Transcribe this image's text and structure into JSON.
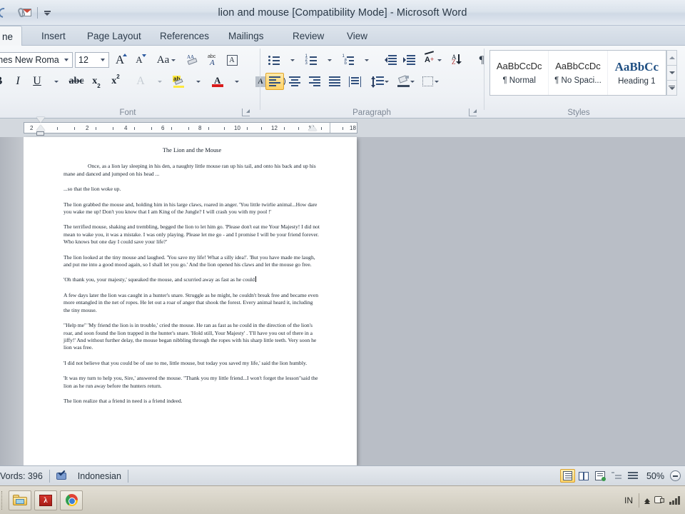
{
  "window": {
    "title": "lion and mouse [Compatibility Mode]  -  Microsoft Word",
    "qat": {
      "undo_icon": "undo-arrow-icon",
      "email_icon": "email-attachment-icon",
      "customize_icon": "customize-quick-access-toolbar-icon"
    }
  },
  "tabs": [
    {
      "label": "ne",
      "name": "tab-home",
      "active": true
    },
    {
      "label": "Insert",
      "name": "tab-insert",
      "active": false
    },
    {
      "label": "Page Layout",
      "name": "tab-page-layout",
      "active": false
    },
    {
      "label": "References",
      "name": "tab-references",
      "active": false
    },
    {
      "label": "Mailings",
      "name": "tab-mailings",
      "active": false
    },
    {
      "label": "Review",
      "name": "tab-review",
      "active": false
    },
    {
      "label": "View",
      "name": "tab-view",
      "active": false
    }
  ],
  "ribbon": {
    "font_group": {
      "label": "Font",
      "font_name": "imes New Roma",
      "font_size": "12",
      "grow_font": "A",
      "shrink_font": "A",
      "change_case": "Aa",
      "clear_formatting": "clear-formatting-icon",
      "phonetic_guide": "abc",
      "character_border": "A",
      "bold": "B",
      "italic": "I",
      "underline": "U",
      "strikethrough": "abc",
      "subscript": "x",
      "superscript": "x",
      "text_effects": "A",
      "highlight": "ab",
      "font_color": "A",
      "shading_char": "A",
      "enclose_char": "enclose-characters-icon"
    },
    "paragraph_group": {
      "label": "Paragraph",
      "bullets": "bullet-list-icon",
      "numbering": "numbered-list-icon",
      "multilevel": "multilevel-list-icon",
      "decrease_indent": "decrease-indent-icon",
      "increase_indent": "increase-indent-icon",
      "sort": "sort-icon",
      "show_marks": "¶",
      "align_left": "align-left-icon",
      "align_center": "align-center-icon",
      "align_right": "align-right-icon",
      "justify": "justify-icon",
      "distributed": "distributed-icon",
      "line_spacing": "line-spacing-icon",
      "shading": "shading-icon",
      "borders": "borders-icon",
      "active_alignment": "align-left"
    },
    "styles_group": {
      "label": "Styles",
      "items": [
        {
          "preview": "AaBbCcDc",
          "name": "¶ Normal"
        },
        {
          "preview": "AaBbCcDc",
          "name": "¶ No Spaci..."
        },
        {
          "preview": "AaBbCс",
          "name": "Heading 1"
        }
      ],
      "scroll_up": "scroll-up-icon",
      "scroll_down": "scroll-down-icon",
      "more_styles": "more-styles-icon"
    }
  },
  "ruler": {
    "marks": [
      "2",
      "2",
      "4",
      "6",
      "8",
      "10",
      "12",
      "14",
      "18"
    ],
    "first_line_indent": "first-line-indent-marker",
    "hanging_indent": "hanging-indent-marker",
    "left_indent": "left-indent-marker",
    "right_indent": "right-indent-marker"
  },
  "document": {
    "title": "The Lion and the Mouse",
    "paragraphs": [
      "Once, as a lion lay sleeping in his den, a naughty little mouse ran up his tail, and onto his back and up his mane and danced and jumped on his head ...",
      "...so that the lion woke up.",
      "The lion grabbed the mouse and, holding him in his large claws, roared in anger. 'You little twirlie animal...How dare you wake me up! Don't you know that I am King of the Jungle? I will crash you with my pool !'",
      "The terrified mouse, shaking and trembling, begged the lion to let him go. 'Please don't eat me Your Majesty! I did not mean to wake you, it was a mistake. I was only playing. Please let me go - and I promise I will be your friend forever. Who knows but one day I could save your life?'",
      "The lion looked at the tiny mouse and laughed. 'You save my life! What a silly idea!'. 'But you have made me laugh, and put me into a good mood again, so I shall let you go.' And the lion opened his claws and let the mouse go free.",
      "'Oh thank you, your majesty,' squeaked the mouse, and scurried away as fast as he could",
      "A few days later the lion was caught in a hunter's snare. Struggle as he might, he couldn't break free and became even more entangled in the net of ropes. He let out a roar of anger that shook the forest. Every animal heard it, including the tiny mouse.",
      "\"Help me\" 'My friend the lion is in trouble,' cried the mouse. He ran as fast as he could in the direction of the lion's roar, and soon found the lion trapped in the hunter's snare. 'Hold still, Your Majesty' . 'I'll have you out of there in a jiffy!' And without further delay, the mouse began nibbling through the ropes with his sharp little teeth. Very soon he lion was free.",
      "'I did not believe that you could be of use to me, little mouse, but today you saved my life,' said the lion humbly.",
      "'It was my turn to help you, Sire,' answered the mouse. \"Thank you my little friend...I won't forget the lesson\"said  the lion as he run away before the hunters return.",
      "The lion realize that a friend in need is a friend indeed."
    ],
    "cursor_after_paragraph_index": 5
  },
  "status_bar": {
    "word_count": "Vords: 396",
    "language": "Indonesian",
    "proofing_icon": "spelling-check-icon",
    "views": [
      {
        "name": "print-layout-view",
        "icon": "print-layout-icon",
        "active": true
      },
      {
        "name": "full-screen-reading-view",
        "icon": "full-screen-reading-icon",
        "active": false
      },
      {
        "name": "web-layout-view",
        "icon": "web-layout-icon",
        "active": false
      },
      {
        "name": "outline-view",
        "icon": "outline-icon",
        "active": false
      },
      {
        "name": "draft-view",
        "icon": "draft-icon",
        "active": false
      }
    ],
    "zoom_level": "50%",
    "zoom_out_icon": "zoom-out-icon"
  },
  "taskbar": {
    "buttons": [
      {
        "name": "file-explorer",
        "icon": "folder-icon"
      },
      {
        "name": "adobe-reader",
        "icon": "pdf-icon",
        "glyph": "λ"
      },
      {
        "name": "google-chrome",
        "icon": "chrome-icon"
      }
    ],
    "tray": {
      "language": "IN",
      "show_hidden_icon": "chevron-up-icon",
      "network_icon": "network-plug-icon",
      "signal_icon": "signal-bars-icon"
    }
  },
  "colors": {
    "accent_gold": "#ffd165",
    "ribbon_bg": "#f1f4f7",
    "workspace_bg": "#b9bec6"
  }
}
